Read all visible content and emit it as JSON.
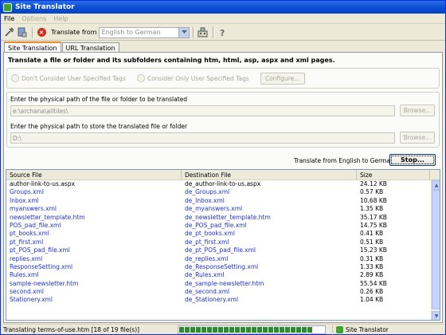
{
  "window": {
    "title": "Site Translator"
  },
  "menu": {
    "items": [
      "File",
      "Options",
      "Help"
    ]
  },
  "toolbar": {
    "translate_from_label": "Translate from",
    "language_pair": "English to German",
    "icons": [
      "tools-icon",
      "document-icon",
      "stop-icon",
      "network-icon",
      "help-icon"
    ]
  },
  "tabs": {
    "site": "Site Translation",
    "url": "URL Translation"
  },
  "main": {
    "headline": "Translate a file or folder and its subfolders containing htm, html, asp, aspx and xml pages.",
    "radio_dont": "Don't Consider User Specified Tags",
    "radio_only": "Consider Only  User Specified Tags",
    "configure": "Configure...",
    "source_label": "Enter the physical path of the file or folder to be translated",
    "source_value": "e:\\archana\\alltiles\\",
    "dest_label": "Enter the physical path to store the translated file or folder",
    "dest_value": "D:\\",
    "browse": "Browse...",
    "translate_status": "Translate from English to German",
    "stop": "Stop..."
  },
  "table": {
    "headers": [
      "Source File",
      "Destination File",
      "Size"
    ],
    "rows": [
      [
        "author-link-to-us.aspx",
        "de_author-link-to-us.aspx",
        "24.12 KB"
      ],
      [
        "Groups.xml",
        "de_Groups.xml",
        "0.57 KB"
      ],
      [
        "Inbox.xml",
        "de_Inbox.xml",
        "10.68 KB"
      ],
      [
        "myanswers.xml",
        "de_myanswers.xml",
        "1.35 KB"
      ],
      [
        "newsletter_template.htm",
        "de_newsletter_template.htm",
        "35.17 KB"
      ],
      [
        "POS_pad_file.xml",
        "de_POS_pad_file.xml",
        "14.75 KB"
      ],
      [
        "pt_books.xml",
        "de_pt_books.xml",
        "0.41 KB"
      ],
      [
        "pt_first.xml",
        "de_pt_first.xml",
        "0.51 KB"
      ],
      [
        "pt_POS_pad_file.xml",
        "de_pt_POS_pad_file.xml",
        "15.23 KB"
      ],
      [
        "replies.xml",
        "de_replies.xml",
        "0.31 KB"
      ],
      [
        "ResponseSetting.xml",
        "de_ResponseSetting.xml",
        "1.33 KB"
      ],
      [
        "Rules.xml",
        "de_Rules.xml",
        "2.89 KB"
      ],
      [
        "sample-newsletter.htm",
        "de_sample-newsletter.htm",
        "55.54 KB"
      ],
      [
        "second.xml",
        "de_second.xml",
        "0.26 KB"
      ],
      [
        "Stationery.xml",
        "de_Stationery.xml",
        "1.04 KB"
      ]
    ]
  },
  "status": {
    "text": "Translating terms-of-use.htm  [18 of 19 file(s)]",
    "progress": 0.947,
    "app": "Site Translator"
  },
  "colors": {
    "titlebar": "#0a4fd3",
    "link": "#1e33c8",
    "progress": "#2b8a2e",
    "tab_accent": "#e68b2c"
  }
}
